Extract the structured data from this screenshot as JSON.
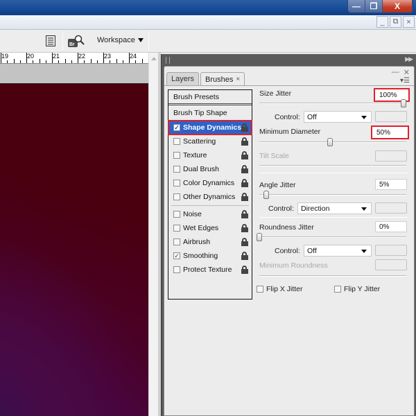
{
  "window": {
    "minimize": "—",
    "restore": "❐",
    "close": "X"
  },
  "document_controls": {
    "minimize": "_",
    "restore": "⧉",
    "close": "×"
  },
  "options_bar": {
    "workspace_label": "Workspace"
  },
  "ruler": {
    "labels": [
      "19",
      "20",
      "21",
      "22",
      "23",
      "24"
    ]
  },
  "colors": {
    "canvas_top": "#4a000e",
    "canvas_bottom_left": "#2e1747",
    "selection": "#2f62c7",
    "highlight": "#e0202a"
  },
  "panel": {
    "tabs": [
      {
        "label": "Layers",
        "active": false
      },
      {
        "label": "Brushes",
        "active": true
      }
    ],
    "close_tab": "×",
    "left_list": {
      "presets": "Brush Presets",
      "tip_shape": "Brush Tip Shape",
      "items": [
        {
          "label": "Shape Dynamics",
          "checked": true,
          "selected": true
        },
        {
          "label": "Scattering",
          "checked": false
        },
        {
          "label": "Texture",
          "checked": false
        },
        {
          "label": "Dual Brush",
          "checked": false
        },
        {
          "label": "Color Dynamics",
          "checked": false
        },
        {
          "label": "Other Dynamics",
          "checked": false
        },
        {
          "label": "Noise",
          "checked": false
        },
        {
          "label": "Wet Edges",
          "checked": false
        },
        {
          "label": "Airbrush",
          "checked": false
        },
        {
          "label": "Smoothing",
          "checked": true
        },
        {
          "label": "Protect Texture",
          "checked": false
        }
      ]
    },
    "settings": {
      "size_jitter": {
        "label": "Size Jitter",
        "value": "100%",
        "slider": 1.0
      },
      "size_control": {
        "label": "Control:",
        "value": "Off"
      },
      "min_diameter": {
        "label": "Minimum Diameter",
        "value": "50%",
        "slider": 0.5
      },
      "tilt_scale": {
        "label": "Tilt Scale"
      },
      "angle_jitter": {
        "label": "Angle Jitter",
        "value": "5%",
        "slider": 0.05
      },
      "angle_control": {
        "label": "Control:",
        "value": "Direction"
      },
      "roundness_jitter": {
        "label": "Roundness Jitter",
        "value": "0%",
        "slider": 0.0
      },
      "roundness_control": {
        "label": "Control:",
        "value": "Off"
      },
      "min_roundness": {
        "label": "Minimum Roundness"
      },
      "flip_x": {
        "label": "Flip X Jitter",
        "checked": false
      },
      "flip_y": {
        "label": "Flip Y Jitter",
        "checked": false
      }
    }
  }
}
